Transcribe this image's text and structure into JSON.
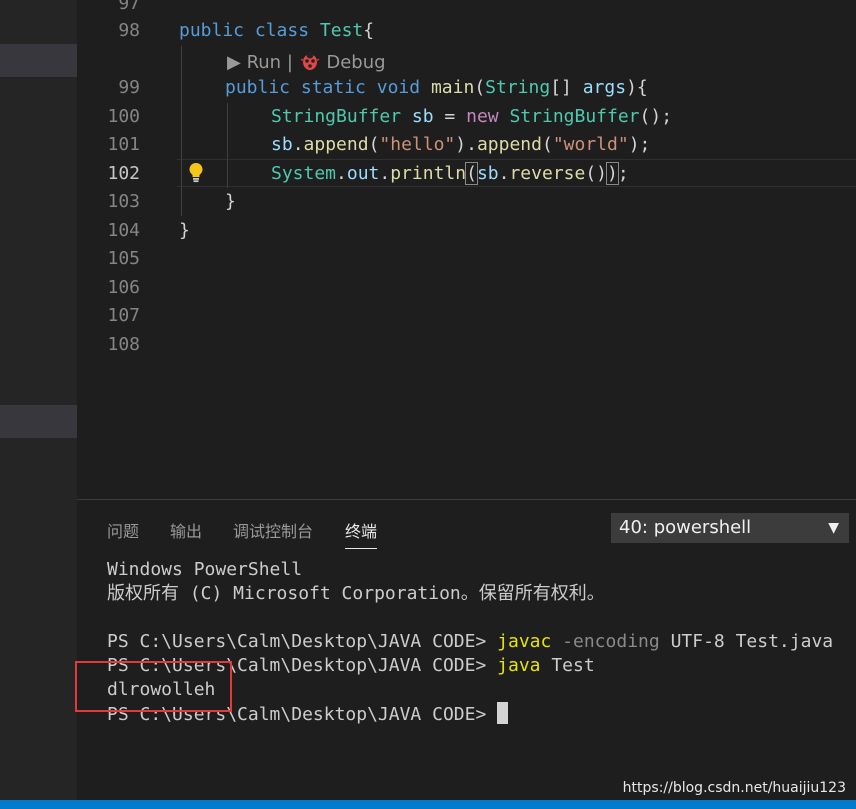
{
  "editor": {
    "line_numbers": [
      "97",
      "98",
      "99",
      "100",
      "101",
      "102",
      "103",
      "104",
      "105",
      "106",
      "107",
      "108"
    ],
    "active_line": "102",
    "codelens": {
      "run": "Run",
      "separator": "|",
      "debug": "Debug"
    },
    "code": {
      "l98": {
        "kw1": "public",
        "kw2": "class",
        "name": "Test",
        "brace": "{"
      },
      "l99": {
        "kw1": "public",
        "kw2": "static",
        "kw3": "void",
        "fn": "main",
        "open": "(",
        "type": "String",
        "arr": "[]",
        "param": "args",
        "close": "){"
      },
      "l100": {
        "type": "StringBuffer",
        "var": "sb",
        "eq": "=",
        "new": "new",
        "type2": "StringBuffer",
        "end": "();"
      },
      "l101": {
        "var": "sb",
        "dot1": ".",
        "m1": "append",
        "p1": "(",
        "s1": "\"hello\"",
        "p2": ").",
        "m2": "append",
        "p3": "(",
        "s2": "\"world\"",
        "p4": ");"
      },
      "l102": {
        "cls": "System",
        "dot1": ".",
        "field": "out",
        "dot2": ".",
        "m": "println",
        "open": "(",
        "var": "sb",
        "dot3": ".",
        "m2": "reverse",
        "call": "()",
        "close": ")",
        "semi": ";"
      },
      "l103": "}",
      "l104": "}"
    }
  },
  "panel": {
    "tabs": [
      "问题",
      "输出",
      "调试控制台",
      "终端"
    ],
    "active_tab": "终端",
    "terminal_select": "40: powershell",
    "terminal": {
      "line1": "Windows PowerShell",
      "line2": "版权所有 (C) Microsoft Corporation。保留所有权利。",
      "prompt": "PS C:\\Users\\Calm\\Desktop\\JAVA CODE> ",
      "cmd1": "javac",
      "cmd1_flag": "-encoding",
      "cmd1_rest": "UTF-8 Test.java",
      "cmd2": "java",
      "cmd2_rest": "Test",
      "output": "dlrowolleh"
    }
  },
  "watermark": "https://blog.csdn.net/huaijiu123",
  "colors": {
    "accent": "#007acc",
    "highlight_box": "#e03a3a",
    "terminal_command": "#e5e500"
  }
}
